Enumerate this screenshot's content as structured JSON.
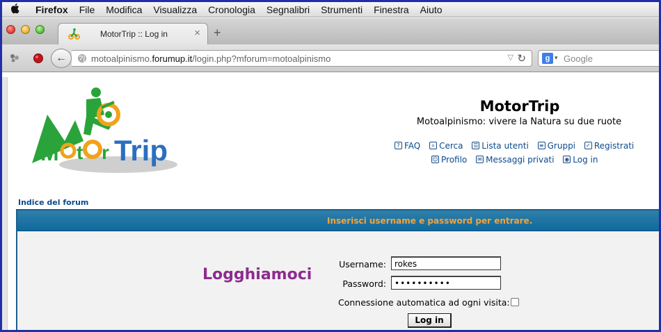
{
  "menubar": {
    "apple_icon": "apple-logo-icon",
    "items": [
      "Firefox",
      "File",
      "Modifica",
      "Visualizza",
      "Cronologia",
      "Segnalibri",
      "Strumenti",
      "Finestra",
      "Aiuto"
    ]
  },
  "tab": {
    "title": "MotorTrip :: Log in",
    "close": "×",
    "new_tab": "+"
  },
  "navbar": {
    "back": "←",
    "url_prefix": "motoalpinismo.",
    "url_host": "forumup.it",
    "url_path": "/login.php?mforum=motoalpinismo",
    "url_dropdown": "▽",
    "reload": "↻",
    "search_engine_icon": "g",
    "search_drop": "▾",
    "search_placeholder": "Google"
  },
  "site": {
    "title": "MotorTrip",
    "subtitle": "Motoalpinismo: vivere la Natura su due ruote",
    "logo_text": "MotorTrip",
    "nav_row1": [
      {
        "label": "FAQ",
        "icon": "?"
      },
      {
        "label": "Cerca",
        "icon": "⌕"
      },
      {
        "label": "Lista utenti",
        "icon": "☰"
      },
      {
        "label": "Gruppi",
        "icon": "≡"
      },
      {
        "label": "Registrati",
        "icon": "✓"
      }
    ],
    "nav_row2": [
      {
        "label": "Profilo",
        "icon": "☺"
      },
      {
        "label": "Messaggi privati",
        "icon": "✉"
      },
      {
        "label": "Log in",
        "icon": "◉"
      }
    ],
    "breadcrumb": "Indice del forum"
  },
  "login": {
    "header": "Inserisci username e password per entrare.",
    "heading": "Logghiamoci",
    "username_label": "Username:",
    "username_value": "rokes",
    "password_label": "Password:",
    "password_value": "••••••••••",
    "auto_label": "Connessione automatica ad ogni visita:",
    "auto_checked": false,
    "button": "Log in"
  },
  "colors": {
    "accent_header": "#0f6a9d",
    "header_text": "#f5a33a",
    "heading": "#8e2b8e",
    "link": "#0b4a8c",
    "logo_green": "#2aa43a",
    "logo_orange": "#f2a21a",
    "logo_blue": "#2b6fc0"
  }
}
